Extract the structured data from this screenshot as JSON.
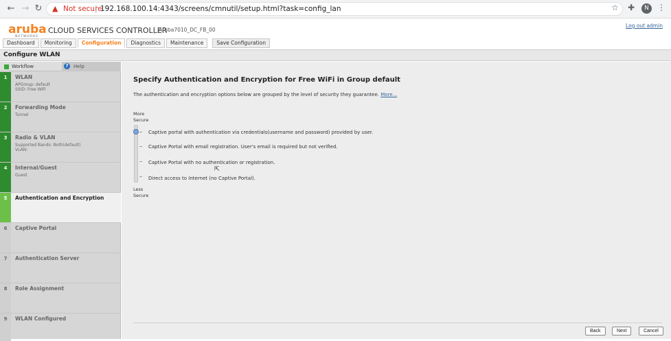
{
  "browser": {
    "not_secure": "Not secure",
    "url": "192.168.100.14:4343/screens/cmnutil/setup.html?task=config_lan",
    "profile_initial": "N"
  },
  "header": {
    "logo": "aruba",
    "logo_sub": "NETWORKS",
    "product": "CLOUD SERVICES CONTROLLER",
    "device": "Aruba7010_DC_FB_00",
    "logout": "Log out admin",
    "tabs": [
      {
        "label": "Dashboard"
      },
      {
        "label": "Monitoring"
      },
      {
        "label": "Configuration"
      },
      {
        "label": "Diagnostics"
      },
      {
        "label": "Maintenance"
      }
    ],
    "save": "Save Configuration"
  },
  "page_title": "Configure WLAN",
  "sidebar": {
    "workflow": "Workflow",
    "help": "Help",
    "steps": [
      {
        "num": "1",
        "title": "WLAN",
        "details": [
          "APGroup: default",
          "SSID: Free WiFi"
        ]
      },
      {
        "num": "2",
        "title": "Forwarding Mode",
        "details": [
          "Tunnel"
        ]
      },
      {
        "num": "3",
        "title": "Radio & VLAN",
        "details": [
          "Supported Bands: Both(default)",
          "VLAN:"
        ]
      },
      {
        "num": "4",
        "title": "Internal/Guest",
        "details": [
          "Guest"
        ]
      },
      {
        "num": "5",
        "title": "Authentication and Encryption",
        "details": []
      },
      {
        "num": "6",
        "title": "Captive Portal",
        "details": []
      },
      {
        "num": "7",
        "title": "Authentication Server",
        "details": []
      },
      {
        "num": "8",
        "title": "Role Assignment",
        "details": []
      },
      {
        "num": "9",
        "title": "WLAN Configured",
        "details": []
      }
    ]
  },
  "main": {
    "title": "Specify Authentication and Encryption for Free WiFi in Group default",
    "description": "The authentication and encryption options below are grouped by the level of security they guarantee.",
    "more": "More...",
    "more_secure_1": "More",
    "more_secure_2": "Secure",
    "less_secure_1": "Less",
    "less_secure_2": "Secure",
    "options": [
      "Captive portal with authentication via credentials(username and password) provided by user.",
      "Captive Portal with email registration. User's email is required but not verified.",
      "Captive Portal with no authentication or registration.",
      "Direct access to Internet (no Captive Portal)."
    ],
    "selected_option_index": 0
  },
  "buttons": {
    "back": "Back",
    "next": "Next",
    "cancel": "Cancel"
  }
}
